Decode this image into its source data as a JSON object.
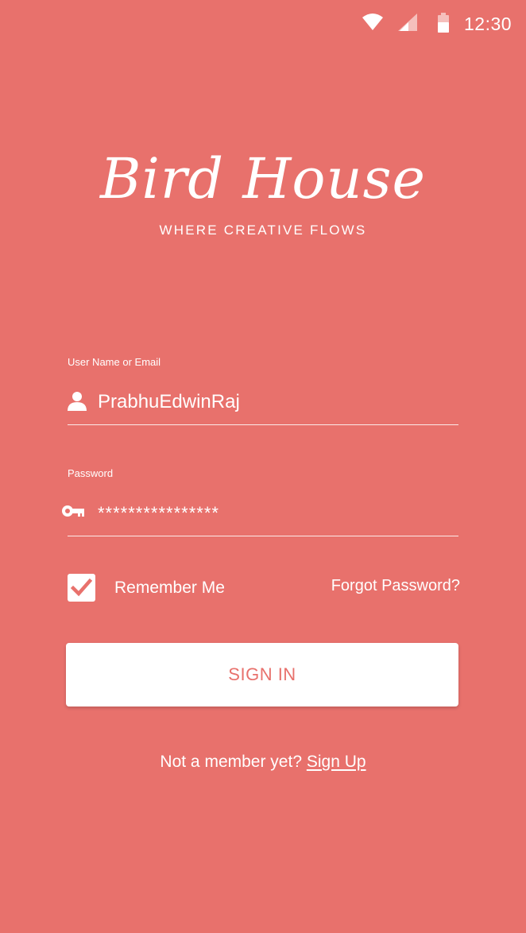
{
  "status_bar": {
    "time": "12:30",
    "icons": [
      "wifi-icon",
      "cellular-signal-icon",
      "battery-icon"
    ]
  },
  "brand": {
    "title": "Bird House",
    "tagline": "WHERE CREATIVE FLOWS"
  },
  "form": {
    "username": {
      "label": "User Name or Email",
      "value": "PrabhuEdwinRaj",
      "icon": "person-icon"
    },
    "password": {
      "label": "Password",
      "value": "****************",
      "icon": "key-icon"
    },
    "remember": {
      "label": "Remember Me",
      "checked": true
    },
    "forgot_label": "Forgot Password?",
    "submit_label": "SIGN IN"
  },
  "signup": {
    "prompt": "Not a member yet?",
    "link_label": "Sign Up"
  },
  "colors": {
    "background": "#e8716c",
    "foreground": "#ffffff",
    "button_text": "#e8716c"
  }
}
